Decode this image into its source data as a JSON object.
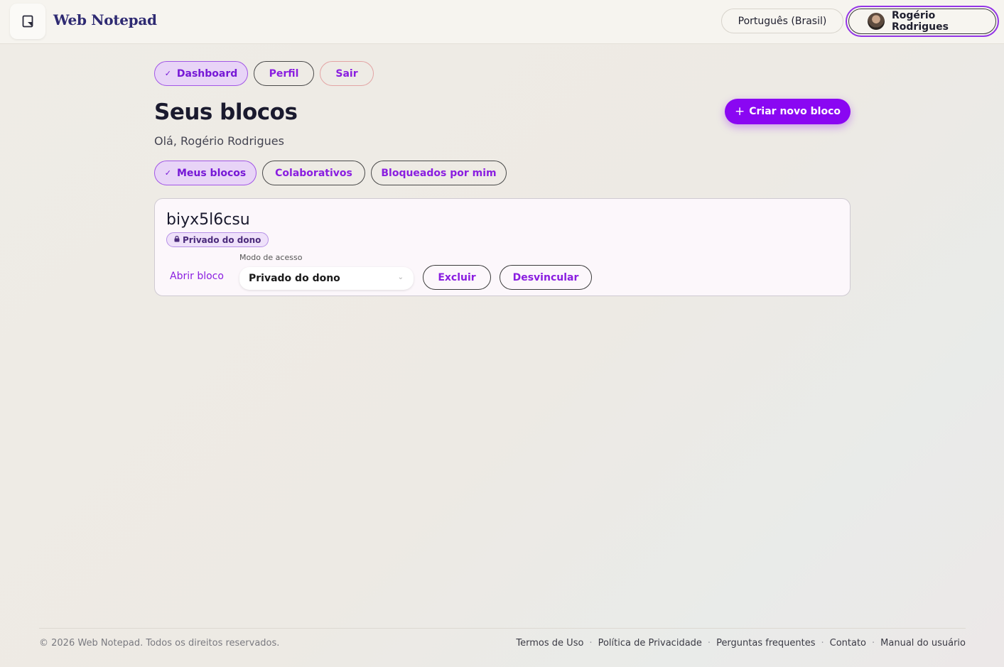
{
  "header": {
    "brand": "Web Notepad",
    "language": "Português (Brasil)",
    "user_name": "Rogério Rodrigues"
  },
  "nav": {
    "dashboard": "Dashboard",
    "profile": "Perfil",
    "logout": "Sair"
  },
  "main": {
    "title": "Seus blocos",
    "greeting": "Olá, Rogério Rodrigues",
    "create_button": "Criar novo bloco",
    "tabs": {
      "mine": "Meus blocos",
      "collaborative": "Colaborativos",
      "blocked": "Bloqueados por mim"
    }
  },
  "block": {
    "name": "biyx5l6csu",
    "badge": "Privado do dono",
    "open_link": "Abrir bloco",
    "access_label": "Modo de acesso",
    "access_value": "Privado do dono",
    "delete": "Excluir",
    "unlink": "Desvincular"
  },
  "footer": {
    "copyright": "© 2026 Web Notepad. Todos os direitos reservados.",
    "links": {
      "terms": "Termos de Uso",
      "privacy": "Política de Privacidade",
      "faq": "Perguntas frequentes",
      "contact": "Contato",
      "manual": "Manual do usuário"
    }
  },
  "colors": {
    "accent": "#8a07f2",
    "accent_text": "#8a1ee0",
    "active_pill_bg": "#e8d4f7"
  },
  "icons": {
    "logo": "notepad-icon",
    "check": "check-icon",
    "plus": "plus-icon",
    "lock": "lock-icon",
    "chevron": "chevron-down-icon"
  }
}
